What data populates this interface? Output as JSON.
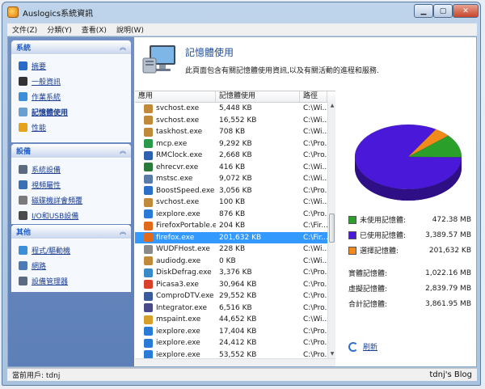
{
  "window": {
    "title": "Auslogics系統資訊"
  },
  "menu": [
    "文件(Z)",
    "分類(Y)",
    "查看(X)",
    "說明(W)"
  ],
  "sidebar": {
    "system": {
      "title": "系統",
      "items": [
        {
          "label": "摘要",
          "icon": "info-icon",
          "color": "#2a6acb"
        },
        {
          "label": "一般資訊",
          "icon": "monitor-icon",
          "color": "#333333"
        },
        {
          "label": "作業系統",
          "icon": "windows-icon",
          "color": "#3b8fd8"
        },
        {
          "label": "記憶體使用",
          "icon": "memory-icon",
          "color": "#6aa0d0",
          "active": true
        },
        {
          "label": "性能",
          "icon": "performance-icon",
          "color": "#e6a21a"
        }
      ]
    },
    "devices": {
      "title": "設備",
      "items": [
        {
          "label": "系統設備",
          "icon": "system-devices-icon",
          "color": "#5a6a80"
        },
        {
          "label": "視頻屬性",
          "icon": "display-icon",
          "color": "#3a70b8"
        },
        {
          "label": "磁碟機詳會頻覆",
          "icon": "disk-icon",
          "color": "#7a7a7a"
        },
        {
          "label": "I/O和USB設備",
          "icon": "usb-icon",
          "color": "#4a4a4a"
        }
      ]
    },
    "other": {
      "title": "其他",
      "items": [
        {
          "label": "程式/驅動機",
          "icon": "programs-icon",
          "color": "#3b8fd8"
        },
        {
          "label": "網路",
          "icon": "network-icon",
          "color": "#4a7ab8"
        },
        {
          "label": "設備管理器",
          "icon": "device-manager-icon",
          "color": "#5a6a80"
        }
      ]
    }
  },
  "page": {
    "title": "記憶體使用",
    "description": "此頁面包含有關記憶體使用資訊,以及有關活動的進程和服務."
  },
  "table": {
    "columns": [
      "應用",
      "記憶體使用",
      "路徑"
    ],
    "rows": [
      {
        "name": "svchost.exe",
        "mem": "5,448 KB",
        "path": "C:\\Wi...",
        "color": "#c08a3a"
      },
      {
        "name": "svchost.exe",
        "mem": "16,552 KB",
        "path": "C:\\Wi...",
        "color": "#c08a3a"
      },
      {
        "name": "taskhost.exe",
        "mem": "708 KB",
        "path": "C:\\Wi...",
        "color": "#c08a3a"
      },
      {
        "name": "mcp.exe",
        "mem": "9,292 KB",
        "path": "C:\\Pro...",
        "color": "#2a9a4a"
      },
      {
        "name": "RMClock.exe",
        "mem": "2,668 KB",
        "path": "C:\\Pro...",
        "color": "#3060b0"
      },
      {
        "name": "ehrecvr.exe",
        "mem": "416 KB",
        "path": "C:\\Wi...",
        "color": "#2a7a3a"
      },
      {
        "name": "mstsc.exe",
        "mem": "9,072 KB",
        "path": "C:\\Wi...",
        "color": "#5a7aa8"
      },
      {
        "name": "BoostSpeed.exe",
        "mem": "3,056 KB",
        "path": "C:\\Pro...",
        "color": "#2a70c8"
      },
      {
        "name": "svchost.exe",
        "mem": "100 KB",
        "path": "C:\\Wi...",
        "color": "#c08a3a"
      },
      {
        "name": "iexplore.exe",
        "mem": "876 KB",
        "path": "C:\\Pro...",
        "color": "#2a7ad8"
      },
      {
        "name": "FirefoxPortable.exe",
        "mem": "204 KB",
        "path": "C:\\Fir...",
        "color": "#e06a1a"
      },
      {
        "name": "firefox.exe",
        "mem": "201,632 KB",
        "path": "C:\\Fir...",
        "color": "#e06a1a",
        "selected": true
      },
      {
        "name": "WUDFHost.exe",
        "mem": "228 KB",
        "path": "C:\\Wi...",
        "color": "#8a8a8a"
      },
      {
        "name": "audiodg.exe",
        "mem": "0 KB",
        "path": "C:\\Wi...",
        "color": "#c08a3a"
      },
      {
        "name": "DiskDefrag.exe",
        "mem": "3,376 KB",
        "path": "C:\\Pro...",
        "color": "#3a8ac8"
      },
      {
        "name": "Picasa3.exe",
        "mem": "30,964 KB",
        "path": "C:\\Pro...",
        "color": "#d8402a"
      },
      {
        "name": "ComproDTV.exe",
        "mem": "29,552 KB",
        "path": "C:\\Pro...",
        "color": "#3a5a9a"
      },
      {
        "name": "Integrator.exe",
        "mem": "6,516 KB",
        "path": "C:\\Pro...",
        "color": "#4a4a8a"
      },
      {
        "name": "mspaint.exe",
        "mem": "44,652 KB",
        "path": "C:\\Wi...",
        "color": "#d8a02a"
      },
      {
        "name": "iexplore.exe",
        "mem": "17,404 KB",
        "path": "C:\\Pro...",
        "color": "#2a7ad8"
      },
      {
        "name": "iexplore.exe",
        "mem": "24,412 KB",
        "path": "C:\\Pro...",
        "color": "#2a7ad8"
      },
      {
        "name": "iexplore.exe",
        "mem": "53,552 KB",
        "path": "C:\\Pro...",
        "color": "#2a7ad8"
      }
    ]
  },
  "memory": {
    "legend": [
      {
        "label": "未使用記憶體:",
        "value": "472.38 MB",
        "color": "#2aa02a"
      },
      {
        "label": "已使用記憶體:",
        "value": "3,389.57 MB",
        "color": "#4a18d8"
      },
      {
        "label": "選擇記憶體:",
        "value": "201,632 KB",
        "color": "#f08a1a"
      }
    ],
    "totals": [
      {
        "label": "實體記憶體:",
        "value": "1,022.16 MB"
      },
      {
        "label": "虛擬記憶體:",
        "value": "2,839.79 MB"
      },
      {
        "label": "合計記憶體:",
        "value": "3,861.95 MB"
      }
    ],
    "refresh_label": "刷新"
  },
  "chart_data": {
    "type": "pie",
    "categories": [
      "未使用記憶體",
      "已使用記憶體",
      "選擇記憶體"
    ],
    "values": [
      472.38,
      3389.57,
      196.91
    ],
    "colors": [
      "#2aa02a",
      "#4a18d8",
      "#f08a1a"
    ]
  },
  "status": {
    "user_label": "當前用戶: tdnj"
  },
  "watermark": "tdnj's Blog"
}
